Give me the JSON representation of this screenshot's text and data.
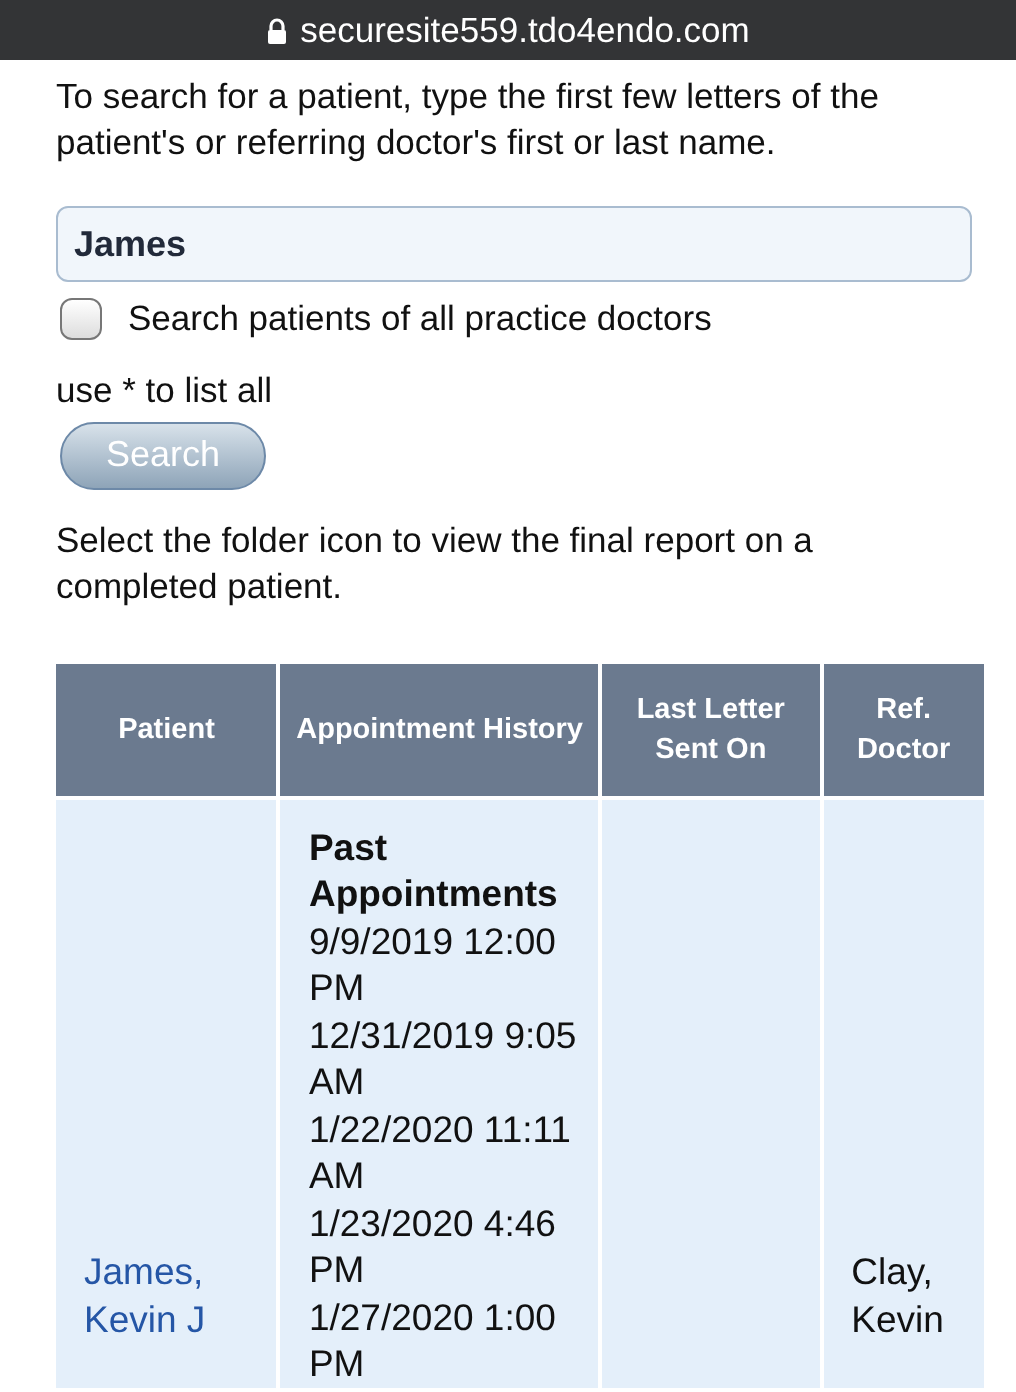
{
  "address_bar": {
    "url": "securesite559.tdo4endo.com"
  },
  "intro": "To search for a patient, type the first few letters of the patient's or referring doctor's first or last name.",
  "search": {
    "value": "James"
  },
  "all_doctors": {
    "label": "Search patients of all practice doctors",
    "checked": false
  },
  "hint": "use * to list all",
  "search_button": "Search",
  "instructions": "Select the folder icon to view the final report on a completed patient.",
  "table": {
    "columns": [
      "Patient",
      "Appointment History",
      "Last Letter Sent On",
      "Ref. Doctor"
    ],
    "rows": [
      {
        "patient": "James, Kevin J",
        "history_heading": "Past Appointments",
        "appointments": [
          "9/9/2019 12:00 PM",
          "12/31/2019 9:05 AM",
          "1/22/2020 11:11 AM",
          "1/23/2020 4:46 PM",
          "1/27/2020 1:00 PM"
        ],
        "ref_doctor": "Clay, Kevin"
      }
    ]
  }
}
